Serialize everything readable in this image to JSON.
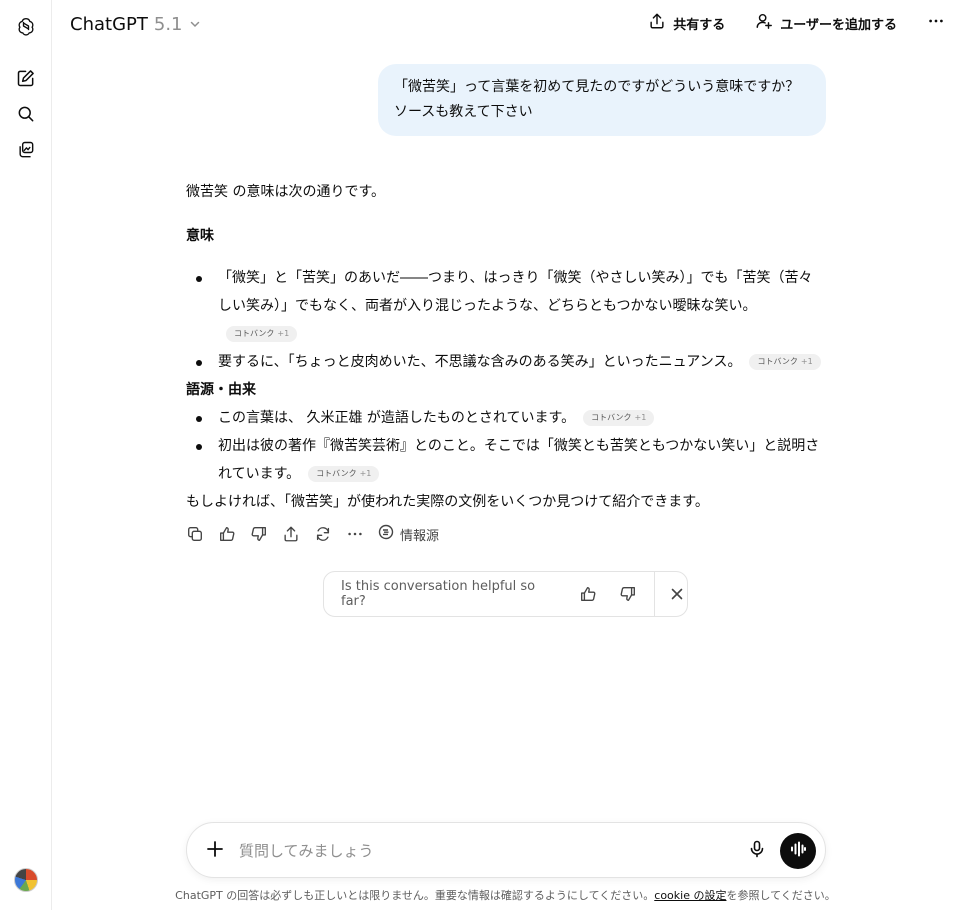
{
  "header": {
    "model_name": "ChatGPT",
    "model_version": "5.1",
    "share_label": "共有する",
    "add_user_label": "ユーザーを追加する"
  },
  "icons": {
    "logo": "openai-logo-icon",
    "new_chat": "new-chat-icon",
    "search": "search-icon",
    "library": "library-icon",
    "more": "more-icon"
  },
  "user_message": "「微苦笑」って言葉を初めて見たのですがどういう意味ですか？ソースも教えて下さい",
  "assistant": {
    "intro": "微苦笑 の意味は次の通りです。",
    "section1_title": "意味",
    "section1_items": [
      {
        "text": "「微笑」と「苦笑」のあいだ――つまり、はっきり「微笑（やさしい笑み）」でも「苦笑（苦々しい笑み）」でもなく、両者が入り混じったような、どちらともつかない曖昧な笑い。",
        "cite": "コトバンク",
        "cite_plus": "+1"
      },
      {
        "text": "要するに、「ちょっと皮肉めいた、不思議な含みのある笑み」といったニュアンス。",
        "cite": "コトバンク",
        "cite_plus": "+1"
      }
    ],
    "section2_title": "語源・由来",
    "section2_items": [
      {
        "text": "この言葉は、 久米正雄 が造語したものとされています。",
        "cite": "コトバンク",
        "cite_plus": "+1"
      },
      {
        "text": "初出は彼の著作『微苦笑芸術』とのこと。そこでは「微笑とも苦笑ともつかない笑い」と説明されています。",
        "cite": "コトバンク",
        "cite_plus": "+1"
      }
    ],
    "outro": "もしよければ、「微苦笑」が使われた実際の文例をいくつか見つけて紹介できます。"
  },
  "actions": {
    "sources_label": "情報源"
  },
  "feedback": {
    "question": "Is this conversation helpful so far?"
  },
  "composer": {
    "placeholder": "質問してみましょう"
  },
  "footer": {
    "disclaimer_before": "ChatGPT の回答は必ずしも正しいとは限りません。重要な情報は確認するようにしてください。",
    "cookie_link": "cookie の設定",
    "disclaimer_after": "を参照してください。"
  }
}
